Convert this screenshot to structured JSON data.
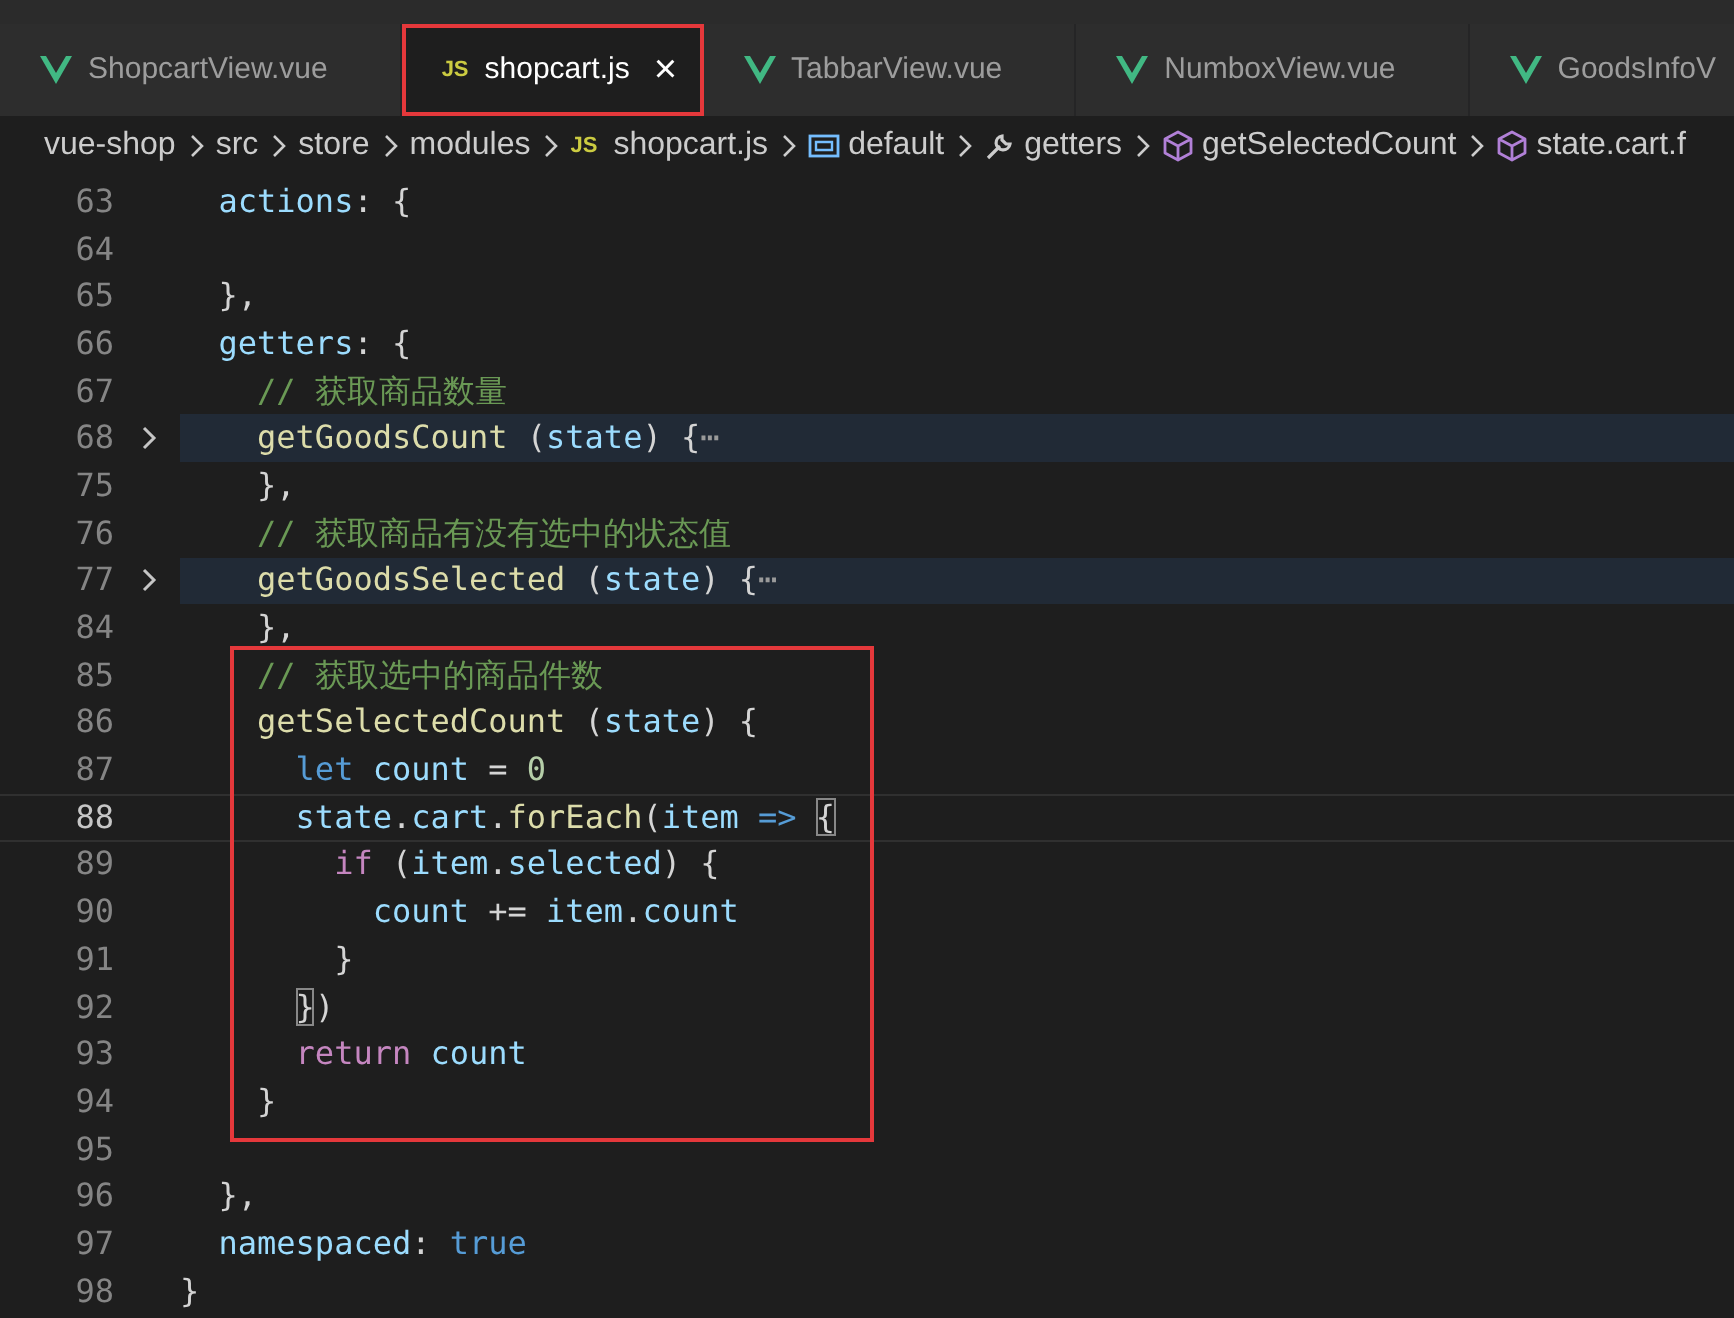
{
  "tabs": [
    {
      "label": "ShopcartView.vue",
      "kind": "vue",
      "selected": false,
      "outlined": false
    },
    {
      "label": "shopcart.js",
      "kind": "js",
      "badge": "JS",
      "selected": true,
      "outlined": true,
      "close": "×"
    },
    {
      "label": "TabbarView.vue",
      "kind": "vue",
      "selected": false,
      "outlined": false
    },
    {
      "label": "NumboxView.vue",
      "kind": "vue",
      "selected": false,
      "outlined": false
    },
    {
      "label": "GoodsInfoV",
      "kind": "vue",
      "selected": false,
      "outlined": false
    }
  ],
  "breadcrumb": [
    {
      "label": "vue-shop",
      "kind": "folder"
    },
    {
      "label": "src",
      "kind": "folder"
    },
    {
      "label": "store",
      "kind": "folder"
    },
    {
      "label": "modules",
      "kind": "folder"
    },
    {
      "label": "shopcart.js",
      "kind": "js",
      "badge": "JS"
    },
    {
      "label": "default",
      "kind": "module"
    },
    {
      "label": "getters",
      "kind": "wrench"
    },
    {
      "label": "getSelectedCount",
      "kind": "cube"
    },
    {
      "label": "state.cart.f",
      "kind": "cube"
    }
  ],
  "editor": {
    "blocks": [
      {
        "boxed": false,
        "lines": [
          {
            "number": "63",
            "folded": false,
            "current": false,
            "tokens": [
              {
                "kind": "prop",
                "text": "  actions"
              },
              {
                "kind": "punct",
                "text": ": {"
              }
            ]
          },
          {
            "number": "64",
            "folded": false,
            "current": false
          },
          {
            "number": "65",
            "folded": false,
            "current": false,
            "tokens": [
              {
                "kind": "punct",
                "text": "  },"
              }
            ]
          },
          {
            "number": "66",
            "folded": false,
            "current": false,
            "tokens": [
              {
                "kind": "prop",
                "text": "  getters"
              },
              {
                "kind": "punct",
                "text": ": {"
              }
            ]
          },
          {
            "number": "67",
            "folded": false,
            "current": false,
            "tokens": [
              {
                "kind": "comment",
                "text": "    // 获取商品数量"
              }
            ]
          },
          {
            "number": "68",
            "folded": true,
            "current": false,
            "tokens": [
              {
                "kind": "func",
                "text": "    getGoodsCount"
              },
              {
                "kind": "punct",
                "text": " ("
              },
              {
                "kind": "prop",
                "text": "state"
              },
              {
                "kind": "punct",
                "text": ") {"
              },
              {
                "kind": "ellipsis",
                "text": "⋯"
              }
            ]
          },
          {
            "number": "75",
            "folded": false,
            "current": false,
            "tokens": [
              {
                "kind": "punct",
                "text": "    },"
              }
            ]
          },
          {
            "number": "76",
            "folded": false,
            "current": false,
            "tokens": [
              {
                "kind": "comment",
                "text": "    // 获取商品有没有选中的状态值"
              }
            ]
          },
          {
            "number": "77",
            "folded": true,
            "current": false,
            "tokens": [
              {
                "kind": "func",
                "text": "    getGoodsSelected"
              },
              {
                "kind": "punct",
                "text": " ("
              },
              {
                "kind": "prop",
                "text": "state"
              },
              {
                "kind": "punct",
                "text": ") {"
              },
              {
                "kind": "ellipsis",
                "text": "⋯"
              }
            ]
          },
          {
            "number": "84",
            "folded": false,
            "current": false,
            "tokens": [
              {
                "kind": "punct",
                "text": "    },"
              }
            ]
          }
        ]
      },
      {
        "boxed": true,
        "lines": [
          {
            "number": "85",
            "folded": false,
            "current": false,
            "tokens": [
              {
                "kind": "comment",
                "text": "    // 获取选中的商品件数"
              }
            ]
          },
          {
            "number": "86",
            "folded": false,
            "current": false,
            "tokens": [
              {
                "kind": "func",
                "text": "    getSelectedCount"
              },
              {
                "kind": "punct",
                "text": " ("
              },
              {
                "kind": "prop",
                "text": "state"
              },
              {
                "kind": "punct",
                "text": ") {"
              }
            ]
          },
          {
            "number": "87",
            "folded": false,
            "current": false,
            "tokens": [
              {
                "kind": "storage",
                "text": "      let"
              },
              {
                "kind": "prop",
                "text": " count"
              },
              {
                "kind": "punct",
                "text": " = "
              },
              {
                "kind": "number",
                "text": "0"
              }
            ]
          },
          {
            "number": "88",
            "folded": false,
            "current": true,
            "tokens": [
              {
                "kind": "prop",
                "text": "      state"
              },
              {
                "kind": "punct",
                "text": "."
              },
              {
                "kind": "prop",
                "text": "cart"
              },
              {
                "kind": "punct",
                "text": "."
              },
              {
                "kind": "func",
                "text": "forEach"
              },
              {
                "kind": "punct",
                "text": "("
              },
              {
                "kind": "prop",
                "text": "item"
              },
              {
                "kind": "storage",
                "text": " => "
              },
              {
                "kind": "match",
                "text": "{"
              }
            ]
          },
          {
            "number": "89",
            "folded": false,
            "current": false,
            "tokens": [
              {
                "kind": "control",
                "text": "        if"
              },
              {
                "kind": "punct",
                "text": " ("
              },
              {
                "kind": "prop",
                "text": "item"
              },
              {
                "kind": "punct",
                "text": "."
              },
              {
                "kind": "prop",
                "text": "selected"
              },
              {
                "kind": "punct",
                "text": ") {"
              }
            ]
          },
          {
            "number": "90",
            "folded": false,
            "current": false,
            "tokens": [
              {
                "kind": "prop",
                "text": "          count"
              },
              {
                "kind": "punct",
                "text": " += "
              },
              {
                "kind": "prop",
                "text": "item"
              },
              {
                "kind": "punct",
                "text": "."
              },
              {
                "kind": "prop",
                "text": "count"
              }
            ]
          },
          {
            "number": "91",
            "folded": false,
            "current": false,
            "tokens": [
              {
                "kind": "punct",
                "text": "        }"
              }
            ]
          },
          {
            "number": "92",
            "folded": false,
            "current": false,
            "tokens": [
              {
                "kind": "match",
                "text": "      }"
              },
              {
                "kind": "punct",
                "text": ")"
              }
            ]
          },
          {
            "number": "93",
            "folded": false,
            "current": false,
            "tokens": [
              {
                "kind": "control",
                "text": "      return"
              },
              {
                "kind": "prop",
                "text": " count"
              }
            ]
          },
          {
            "number": "94",
            "folded": false,
            "current": false,
            "tokens": [
              {
                "kind": "punct",
                "text": "    }"
              }
            ]
          }
        ]
      },
      {
        "boxed": false,
        "lines": [
          {
            "number": "95",
            "folded": false,
            "current": false
          },
          {
            "number": "96",
            "folded": false,
            "current": false,
            "tokens": [
              {
                "kind": "punct",
                "text": "  },"
              }
            ]
          },
          {
            "number": "97",
            "folded": false,
            "current": false,
            "tokens": [
              {
                "kind": "prop",
                "text": "  namespaced"
              },
              {
                "kind": "punct",
                "text": ": "
              },
              {
                "kind": "bool",
                "text": "true"
              }
            ]
          },
          {
            "number": "98",
            "folded": false,
            "current": false,
            "tokens": [
              {
                "kind": "punct",
                "text": "}"
              }
            ]
          }
        ]
      }
    ]
  }
}
